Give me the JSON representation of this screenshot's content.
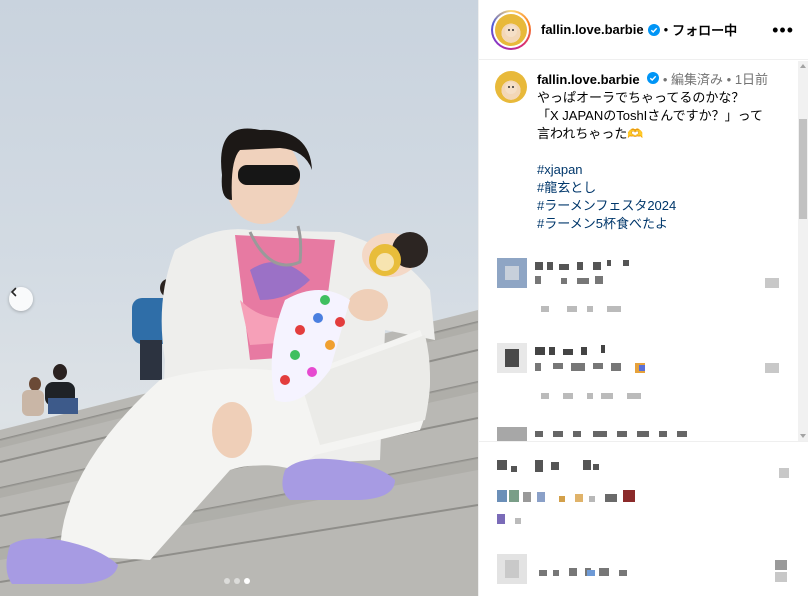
{
  "post": {
    "username": "fallin.love.barbie",
    "follow_status": "フォロー中",
    "separator": "•",
    "more_label": "•••"
  },
  "caption": {
    "username": "fallin.love.barbie",
    "edited": "編集済み",
    "time": "1日前",
    "line1": "やっぱオーラでちゃってるのかな？",
    "line2": "「X JAPANのToshIさんですか？」って",
    "line3": "言われちゃった🫶",
    "hashtags": [
      "#xjapan",
      "#龍玄とし",
      "#ラーメンフェスタ2024",
      "#ラーメン5杯食べたよ"
    ]
  },
  "carousel": {
    "current": 3,
    "total": 3
  },
  "icons": {
    "verified": "verified-badge-icon",
    "prev": "chevron-left-icon",
    "more": "more-options-icon"
  },
  "colors": {
    "verified": "#0095f6",
    "link": "#00376b",
    "muted": "#737373"
  }
}
